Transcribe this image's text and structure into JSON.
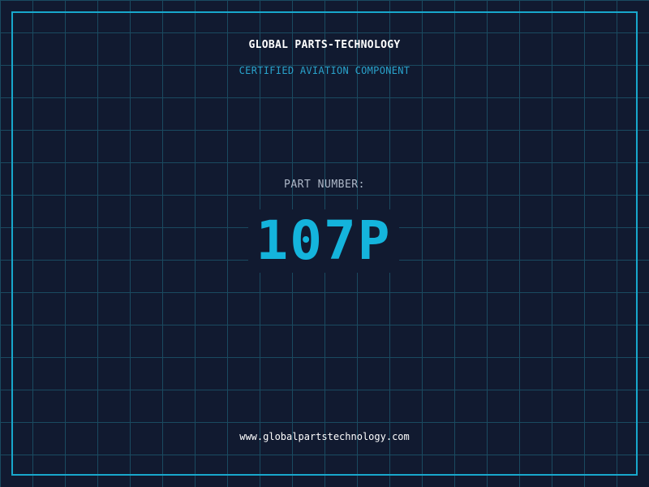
{
  "brand": {
    "title": "GLOBAL PARTS-TECHNOLOGY",
    "subtitle": "CERTIFIED AVIATION COMPONENT"
  },
  "part": {
    "label": "PART NUMBER:",
    "number": "107P"
  },
  "footer": {
    "website": "www.globalpartstechnology.com"
  },
  "colors": {
    "background": "#111a30",
    "grid": "#1a4a60",
    "frame": "#18a8cc",
    "accent": "#14b4dc",
    "subtitle": "#29a3cc",
    "label": "#aeb8c8",
    "text": "#ffffff"
  }
}
